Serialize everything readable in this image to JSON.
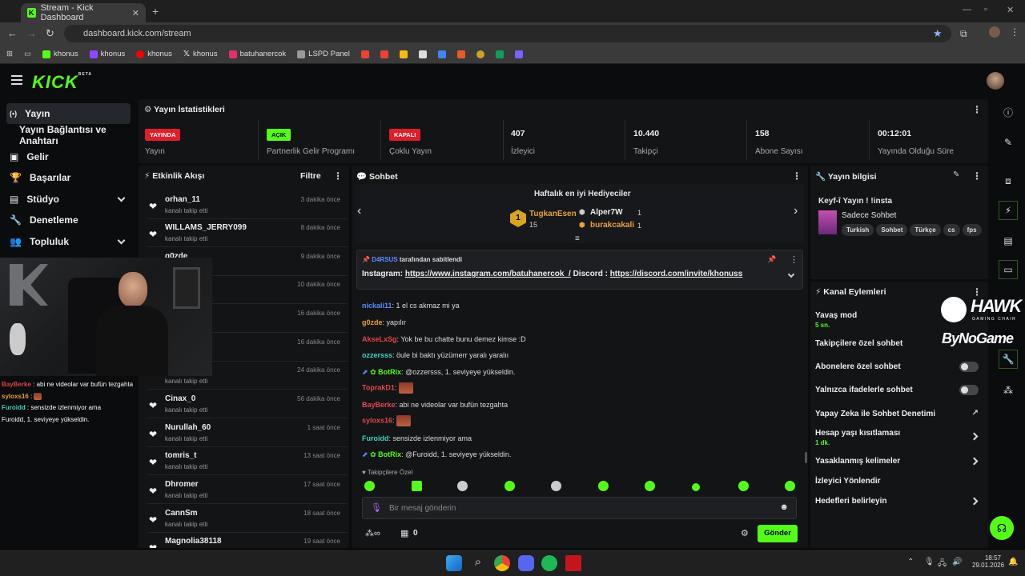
{
  "browser": {
    "tab_title": "Stream - Kick Dashboard",
    "url": "dashboard.kick.com/stream",
    "bookmarks": [
      {
        "label": "khonus",
        "color": "#53fc18"
      },
      {
        "label": "khonus",
        "color": "#9146ff"
      },
      {
        "label": "khonus",
        "color": "#ff0000"
      },
      {
        "label": "khonus",
        "color": "#ffffff"
      },
      {
        "label": "batuhanercok",
        "color": "#e1306c"
      },
      {
        "label": "LSPD Panel",
        "color": "#cccccc"
      }
    ]
  },
  "brand": {
    "logo": "KICK",
    "beta": "BETA",
    "accent": "#53fc18"
  },
  "sidebar": {
    "items": [
      {
        "label": "Yayın",
        "icon": "broadcast-icon",
        "active": true
      },
      {
        "label": "Yayın Bağlantısı ve Anahtarı",
        "icon": ""
      },
      {
        "label": "Gelir",
        "icon": "money-icon"
      },
      {
        "label": "Başarılar",
        "icon": "trophy-icon"
      },
      {
        "label": "Stüdyo",
        "icon": "studio-icon"
      },
      {
        "label": "Denetleme",
        "icon": "wrench-icon"
      },
      {
        "label": "Topluluk",
        "icon": "community-icon"
      }
    ]
  },
  "stats": {
    "title": "Yayın İstatistikleri",
    "cells": [
      {
        "badge": "YAYINDA",
        "badge_color": "#e11d2a",
        "label": "Yayın"
      },
      {
        "badge": "AÇIK",
        "badge_color": "#53fc18",
        "label": "Partnerlik Gelir Programı"
      },
      {
        "badge": "KAPALI",
        "badge_color": "#e11d2a",
        "label": "Çoklu Yayın"
      },
      {
        "value": "407",
        "label": "İzleyici"
      },
      {
        "value": "10.440",
        "label": "Takipçi"
      },
      {
        "value": "158",
        "label": "Abone Sayısı"
      },
      {
        "value": "00:12:01",
        "label": "Yayında Olduğu Süre"
      }
    ]
  },
  "activity": {
    "title": "Etkinlik Akışı",
    "filter": "Filtre",
    "items": [
      {
        "name": "orhan_11",
        "sub": "kanalı takip etti",
        "time": "3 dakika önce"
      },
      {
        "name": "WILLAMS_JERRY099",
        "sub": "kanalı takip etti",
        "time": "8 dakika önce"
      },
      {
        "name": "g0zde",
        "sub": "",
        "time": "9 dakika önce"
      },
      {
        "name": "",
        "sub": "",
        "time": "10 dakika önce"
      },
      {
        "name": "",
        "sub": "",
        "time": "16 dakika önce"
      },
      {
        "name": "",
        "sub": "",
        "time": "16 dakika önce"
      },
      {
        "name": "",
        "sub": "kanalı takip etti",
        "time": "24 dakika önce"
      },
      {
        "name": "Cinax_0",
        "sub": "kanalı takip etti",
        "time": "56 dakika önce"
      },
      {
        "name": "Nurullah_60",
        "sub": "kanalı takip etti",
        "time": "1 saat önce"
      },
      {
        "name": "tomris_t",
        "sub": "kanalı takip etti",
        "time": "13 saat önce"
      },
      {
        "name": "Dhromer",
        "sub": "kanalı takip etti",
        "time": "17 saat önce"
      },
      {
        "name": "CannSm",
        "sub": "kanalı takip etti",
        "time": "18 saat önce"
      },
      {
        "name": "Magnolia38118",
        "sub": "",
        "time": "19 saat önce"
      }
    ]
  },
  "chat": {
    "title": "Sohbet",
    "gifters_title": "Haftalık en iyi Hediyeciler",
    "gifters": [
      {
        "rank": "1",
        "name": "TugkanEsen",
        "count": "15"
      },
      {
        "name": "Alper7W",
        "count": "1"
      },
      {
        "name": "burakcakali",
        "count": "1"
      }
    ],
    "pinned_by": "D4RSUS",
    "pinned_suffix": "tarafından sabitlendi",
    "pinned_prefix": "Instagram:",
    "pinned_link1": "https://www.instagram.com/batuhanercok_/",
    "pinned_mid": "Discord :",
    "pinned_link2": "https://discord.com/invite/khonuss",
    "messages": [
      {
        "user": "nickali11",
        "color": "#5b8cff",
        "text": "1 el cs akmaz mi ya"
      },
      {
        "user": "g0zde",
        "color": "#e8a23b",
        "text": "yapılır"
      },
      {
        "user": "AkseLxSg",
        "color": "#e0474c",
        "text": "Yok be bu chatte bunu demez kimse :D"
      },
      {
        "user": "ozzersss",
        "color": "#3fd3c2",
        "text": "öule bi baktı yüzümerr yaralı yaralıı"
      },
      {
        "user": "BotRix",
        "color": "#53fc18",
        "text": "@ozzersss, 1. seviyeye yükseldin."
      },
      {
        "user": "ToprakD1",
        "color": "#e0474c",
        "text": ""
      },
      {
        "user": "BayBerke",
        "color": "#e0474c",
        "text": "abi ne videolar var bufün tezgahta"
      },
      {
        "user": "syloxs16",
        "color": "#e0474c",
        "text": ""
      },
      {
        "user": "Furoidd",
        "color": "#3fd3c2",
        "text": "sensizde izlenmiyor ama"
      },
      {
        "user": "BotRix",
        "color": "#53fc18",
        "text": "@Furoidd, 1. seviyeye yükseldin."
      }
    ],
    "followers_only": "Takipçilere Özel",
    "input_placeholder": "Bir mesaj gönderin",
    "points": "0",
    "send": "Gönder"
  },
  "stream_info": {
    "title": "Yayın bilgisi",
    "stream_title": "Keyf-î Yayın ! !insta",
    "category": "Sadece Sohbet",
    "tags": [
      "Turkish",
      "Sohbet",
      "Türkçe",
      "cs",
      "fps"
    ]
  },
  "channel_actions": {
    "title": "Kanal Eylemleri",
    "items": [
      {
        "label": "Yavaş mod",
        "sub": "5 sn.",
        "control": ""
      },
      {
        "label": "Takipçilere özel sohbet",
        "sub": "",
        "control": ""
      },
      {
        "label": "Abonelere özel sohbet",
        "sub": "",
        "control": "toggle"
      },
      {
        "label": "Yalnızca ifadelerle sohbet",
        "sub": "",
        "control": "toggle"
      },
      {
        "label": "Yapay Zeka ile Sohbet Denetimi",
        "sub": "",
        "control": "external"
      },
      {
        "label": "Hesap yaşı kısıtlaması",
        "sub": "1 dk.",
        "control": "arrow"
      },
      {
        "label": "Yasaklanmış kelimeler",
        "sub": "",
        "control": "arrow"
      },
      {
        "label": "İzleyici Yönlendir",
        "sub": "",
        "control": ""
      },
      {
        "label": "Hedefleri belirleyin",
        "sub": "",
        "control": "arrow"
      }
    ]
  },
  "overlay": {
    "hawk": "HAWK",
    "hawk_sub": "GAMING CHAIR",
    "bynogame": "ByNoGame",
    "cam_chat": [
      {
        "user": "BayBerke",
        "color": "#e0474c",
        "text": "abi ne videolar var bufün tezgahta"
      },
      {
        "user": "syloxs16",
        "color": "#e8a23b",
        "text": ""
      },
      {
        "user": "Furoidd",
        "color": "#3fd3c2",
        "text": "sensizde izlenmiyor ama"
      },
      {
        "user": "",
        "color": "#ffffff",
        "text": "Furoidd, 1. seviyeye yükseldin."
      }
    ]
  },
  "taskbar": {
    "time": "18:57",
    "date": "29.01.2026"
  }
}
